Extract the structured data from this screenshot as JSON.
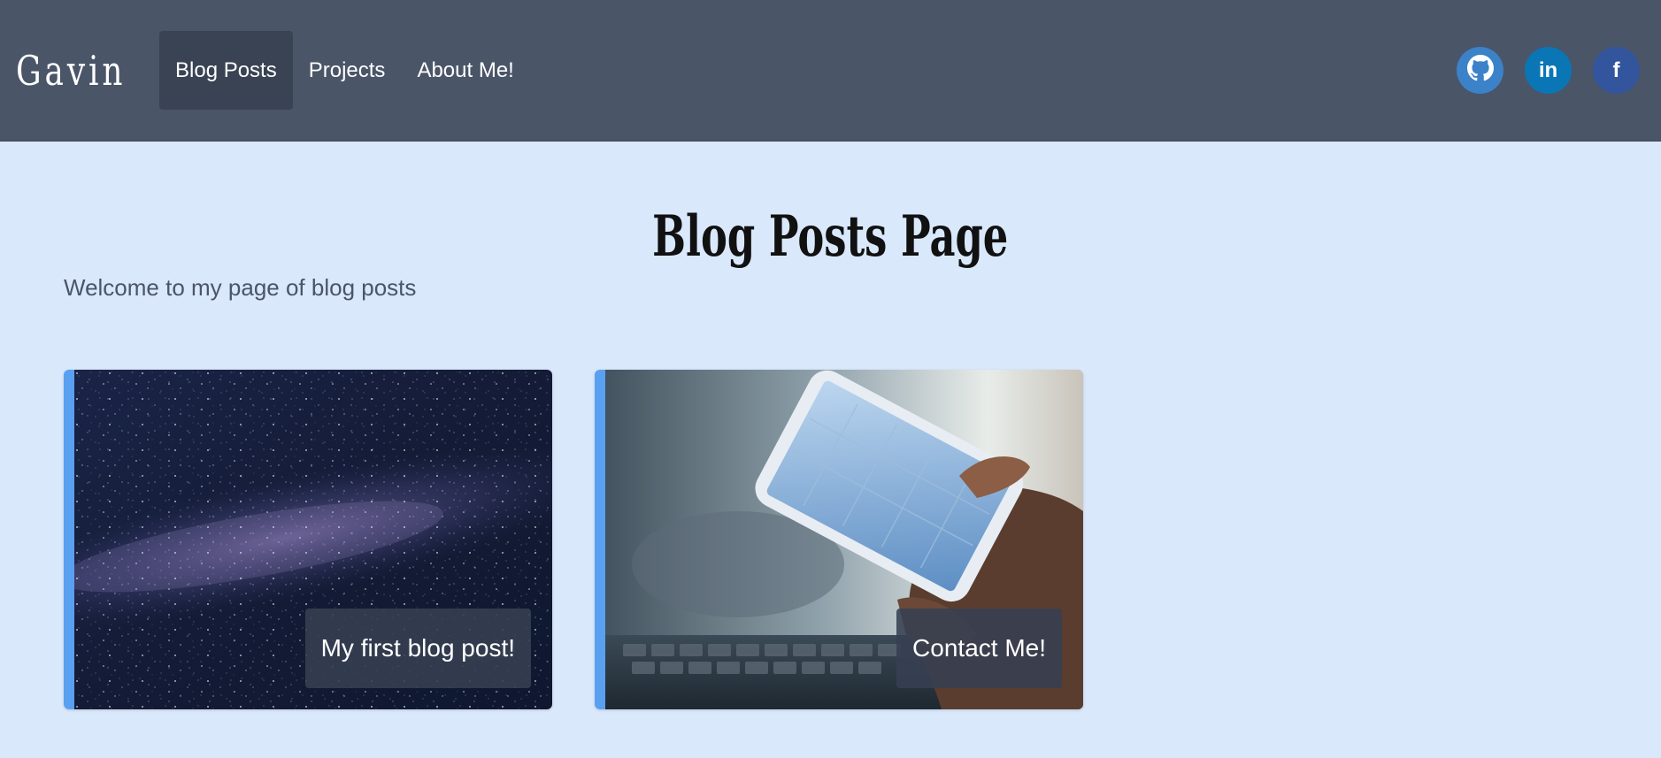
{
  "nav": {
    "brand": "Gavin",
    "links": [
      {
        "label": "Blog Posts",
        "active": true
      },
      {
        "label": "Projects",
        "active": false
      },
      {
        "label": "About Me!",
        "active": false
      }
    ],
    "social": [
      {
        "icon": "github-icon",
        "color": "#3b82c9"
      },
      {
        "icon": "linkedin-icon",
        "text": "in",
        "color": "#0b76b5"
      },
      {
        "icon": "facebook-icon",
        "text": "f",
        "color": "#33559e"
      }
    ]
  },
  "main": {
    "title": "Blog Posts Page",
    "subtitle": "Welcome to my page of blog posts",
    "cards": [
      {
        "label": "My first blog post!",
        "image": "milky-way-night-sky"
      },
      {
        "label": "Contact Me!",
        "image": "hand-holding-smartphone"
      }
    ]
  },
  "colors": {
    "navbar": "#4a5568",
    "page_background": "#dae8fc",
    "card_accent": "#5aa0f0"
  }
}
